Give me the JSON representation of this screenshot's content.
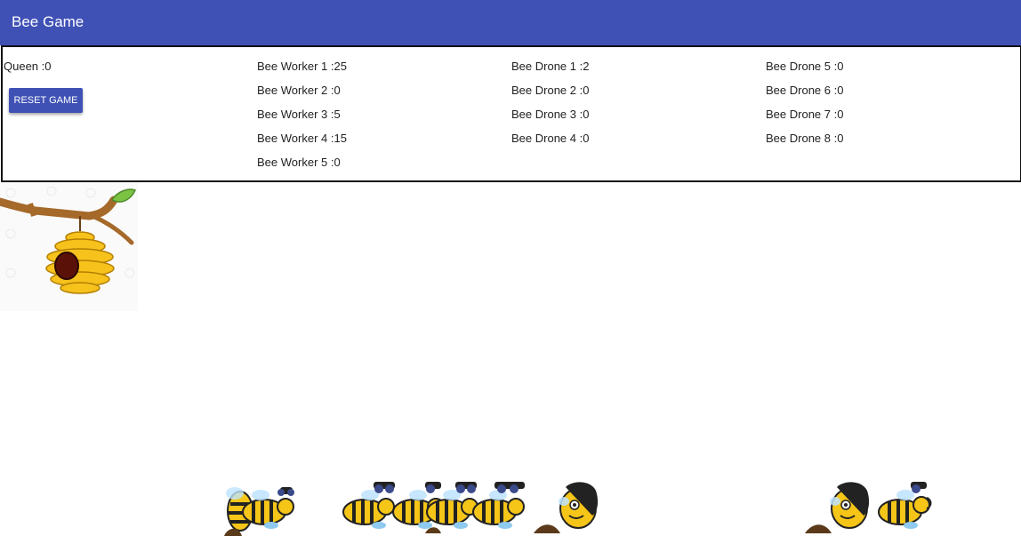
{
  "app": {
    "title": "Bee Game"
  },
  "queen": {
    "label": "Queen :0"
  },
  "reset_button": {
    "label": "RESET GAME"
  },
  "workers": [
    {
      "label": "Bee Worker 1 :25"
    },
    {
      "label": "Bee Worker 2 :0"
    },
    {
      "label": "Bee Worker 3 :5"
    },
    {
      "label": "Bee Worker 4 :15"
    },
    {
      "label": "Bee Worker 5 :0"
    }
  ],
  "drones_a": [
    {
      "label": "Bee Drone 1 :2"
    },
    {
      "label": "Bee Drone 2 :0"
    },
    {
      "label": "Bee Drone 3 :0"
    },
    {
      "label": "Bee Drone 4 :0"
    }
  ],
  "drones_b": [
    {
      "label": "Bee Drone 5 :0"
    },
    {
      "label": "Bee Drone 6 :0"
    },
    {
      "label": "Bee Drone 7 :0"
    },
    {
      "label": "Bee Drone 8 :0"
    }
  ],
  "colors": {
    "appbar": "#3f51b5",
    "bee_yellow": "#f5c518",
    "bee_dark": "#222222"
  }
}
